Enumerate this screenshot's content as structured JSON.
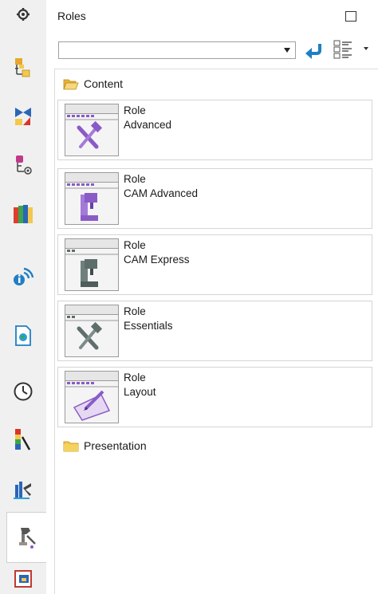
{
  "panel": {
    "title": "Roles",
    "role_select_value": ""
  },
  "tree": {
    "content_folder": "Content",
    "presentation_folder": "Presentation"
  },
  "roles": [
    {
      "type": "Role",
      "name": "Advanced"
    },
    {
      "type": "Role",
      "name": "CAM Advanced"
    },
    {
      "type": "Role",
      "name": "CAM Express"
    },
    {
      "type": "Role",
      "name": "Essentials"
    },
    {
      "type": "Role",
      "name": "Layout"
    }
  ],
  "sidebar_icons": [
    "settings-gear-icon",
    "assembly-navigator-icon",
    "constraint-navigator-icon",
    "part-navigator-icon",
    "reuse-library-icon",
    "hd3d-tools-icon",
    "web-browser-icon",
    "history-icon",
    "visualization-palette-icon",
    "process-studio-icon",
    "roles-icon",
    "system-materials-icon"
  ],
  "colors": {
    "accent_blue": "#1f7fc4",
    "folder_yellow": "#f2c94c",
    "role_purple": "#8a5bc7",
    "role_gray": "#5e6e6a"
  }
}
